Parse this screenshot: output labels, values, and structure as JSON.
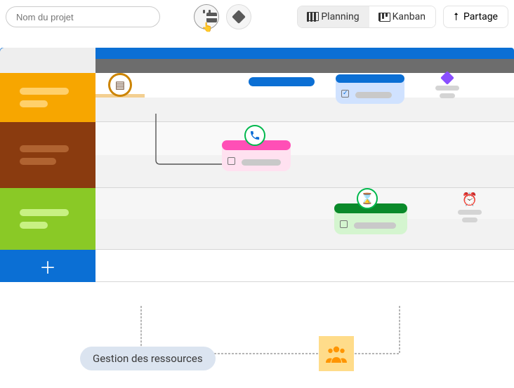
{
  "project_name_placeholder": "Nom du projet",
  "views": {
    "planning_label": "Planning",
    "kanban_label": "Kanban"
  },
  "share_label": "Partage",
  "add_row_glyph": "＋",
  "resources_label": "Gestion des ressources",
  "icons": {
    "calendar": "calendar-icon",
    "milestone": "milestone-icon",
    "cursor": "👆",
    "upload": "⭡",
    "book": "📖",
    "phone": "📞",
    "hourglass": "⏳",
    "alarm": "⏰",
    "people": "👥"
  },
  "colors": {
    "primary_blue": "#0b6fd4",
    "group_orange": "#f7a600",
    "group_brown": "#8a3b0f",
    "group_green": "#8ac926",
    "pink": "#ff4fb6",
    "dark_green": "#0a8a2a",
    "purple": "#8a4fff"
  },
  "groups": [
    {
      "color": "orange"
    },
    {
      "color": "brown"
    },
    {
      "color": "green"
    }
  ]
}
